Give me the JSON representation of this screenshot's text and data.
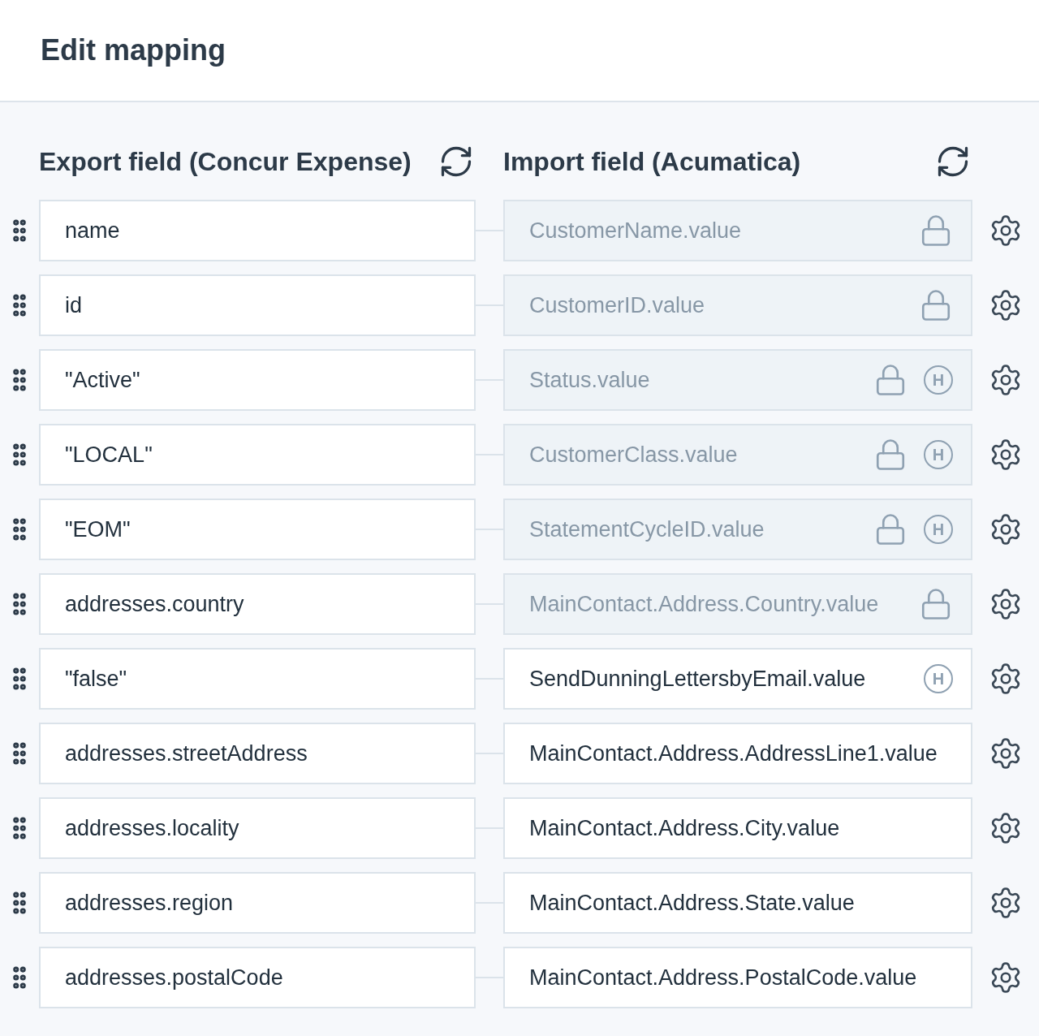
{
  "title": "Edit mapping",
  "export_header": "Export field (Concur Expense)",
  "import_header": "Import field (Acumatica)",
  "rows": [
    {
      "export": "name",
      "import": "CustomerName.value",
      "locked": true
    },
    {
      "export": "id",
      "import": "CustomerID.value",
      "locked": true
    },
    {
      "export": "\"Active\"",
      "import": "Status.value",
      "locked": true,
      "badge": "H"
    },
    {
      "export": "\"LOCAL\"",
      "import": "CustomerClass.value",
      "locked": true,
      "badge": "H"
    },
    {
      "export": "\"EOM\"",
      "import": "StatementCycleID.value",
      "locked": true,
      "badge": "H"
    },
    {
      "export": "addresses.country",
      "import": "MainContact.Address.Country.value",
      "locked": true
    },
    {
      "export": "\"false\"",
      "import": "SendDunningLettersbyEmail.value",
      "locked": false,
      "badge": "H"
    },
    {
      "export": "addresses.streetAddress",
      "import": "MainContact.Address.AddressLine1.value",
      "locked": false
    },
    {
      "export": "addresses.locality",
      "import": "MainContact.Address.City.value",
      "locked": false
    },
    {
      "export": "addresses.region",
      "import": "MainContact.Address.State.value",
      "locked": false
    },
    {
      "export": "addresses.postalCode",
      "import": "MainContact.Address.PostalCode.value",
      "locked": false
    }
  ]
}
